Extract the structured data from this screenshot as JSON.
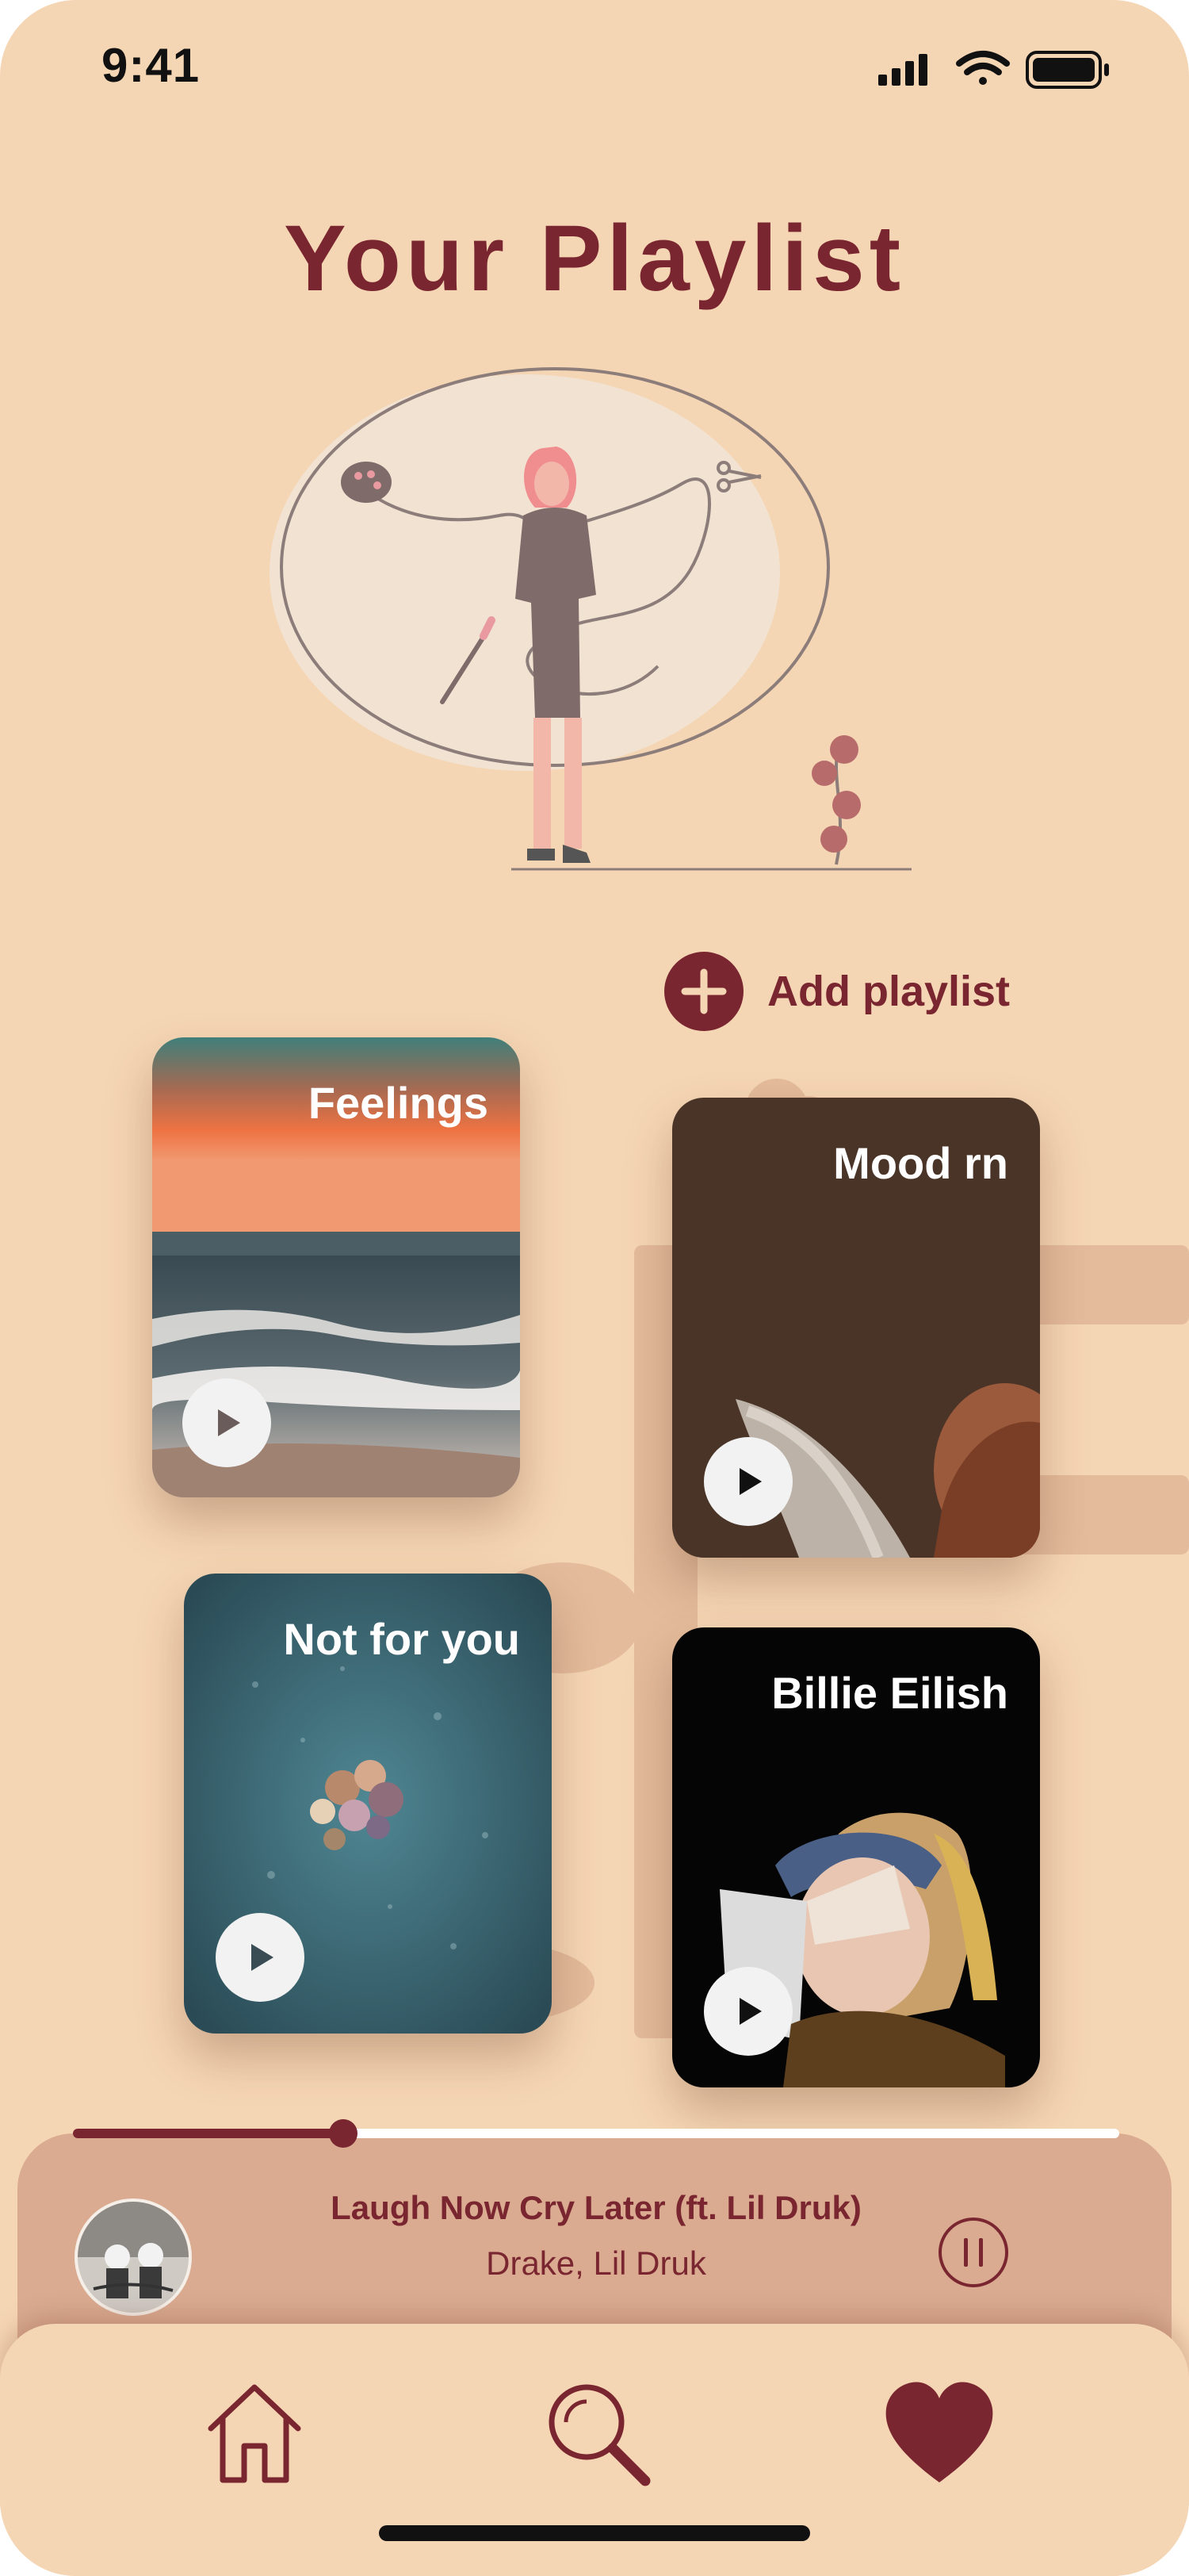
{
  "status": {
    "time": "9:41",
    "icons": [
      "signal-icon",
      "wifi-icon",
      "battery-icon"
    ]
  },
  "header": {
    "title": "Your Playlist"
  },
  "actions": {
    "add_playlist_label": "Add playlist"
  },
  "playlists": [
    {
      "title": "Feelings"
    },
    {
      "title": "Mood rn"
    },
    {
      "title": "Not for you"
    },
    {
      "title": "Billie Eilish"
    }
  ],
  "now_playing": {
    "song": "Laugh Now Cry Later (ft. Lil Druk)",
    "artist": "Drake, Lil Druk",
    "progress": 0.258
  },
  "nav": {
    "items": [
      "home-icon",
      "search-icon",
      "heart-icon"
    ],
    "active": "heart-icon"
  },
  "colors": {
    "background": "#f5d6b4",
    "accent": "#7a2630",
    "player": "#daab91"
  }
}
